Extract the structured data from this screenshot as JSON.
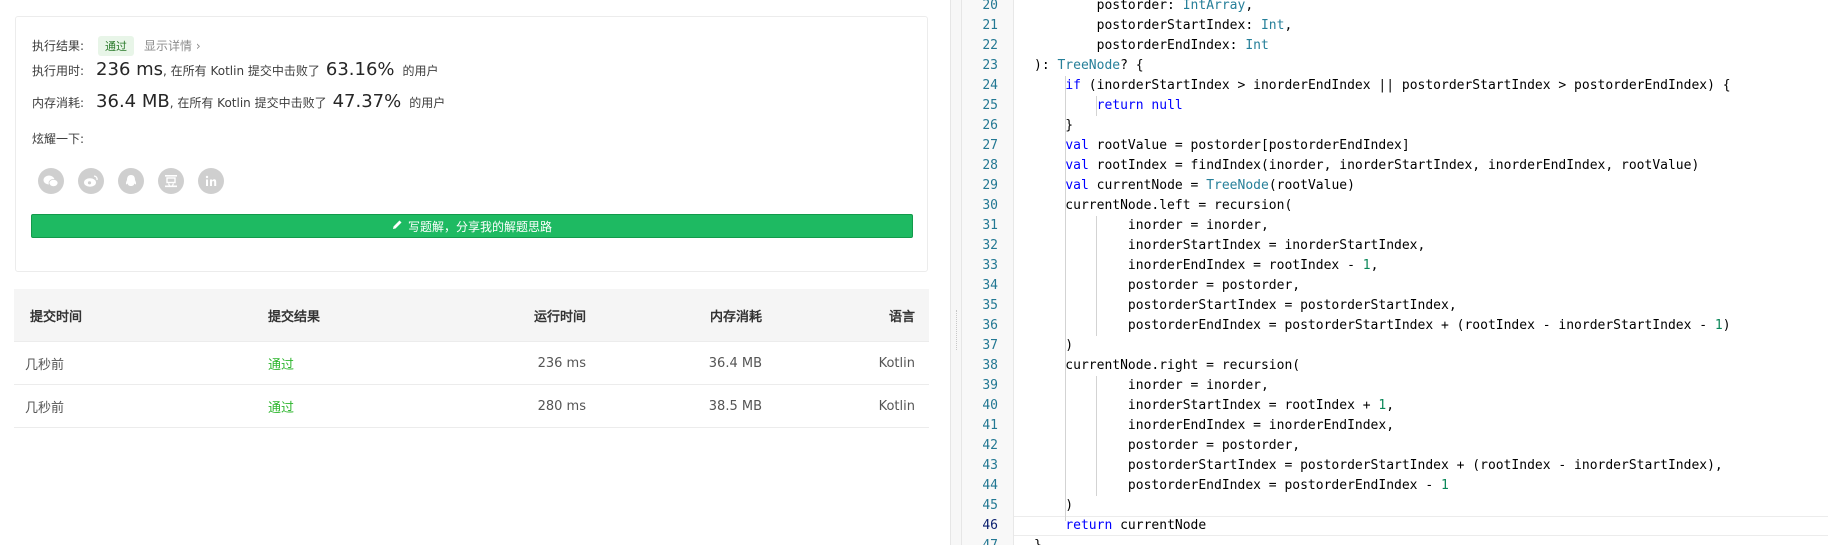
{
  "result": {
    "status_label": "执行结果:",
    "status_badge": "通过",
    "detail_link": "显示详情 ›",
    "runtime_label": "执行用时:",
    "runtime_value": "236 ms",
    "runtime_desc": ", 在所有 Kotlin 提交中击败了",
    "runtime_pct": "63.16%",
    "runtime_suffix": "的用户",
    "memory_label": "内存消耗:",
    "memory_value": "36.4 MB",
    "memory_desc": ", 在所有 Kotlin 提交中击败了",
    "memory_pct": "47.37%",
    "memory_suffix": "的用户",
    "share_label": "炫耀一下:",
    "share_icons": [
      "wechat-icon",
      "weibo-icon",
      "qq-icon",
      "douban-icon",
      "linkedin-icon"
    ],
    "write_button": "写题解，分享我的解题思路"
  },
  "submissions": {
    "headers": [
      "提交时间",
      "提交结果",
      "运行时间",
      "内存消耗",
      "语言"
    ],
    "rows": [
      [
        "几秒前",
        "通过",
        "236 ms",
        "36.4 MB",
        "Kotlin"
      ],
      [
        "几秒前",
        "通过",
        "280 ms",
        "38.5 MB",
        "Kotlin"
      ]
    ]
  },
  "editor": {
    "lines": [
      {
        "n": "20",
        "tokens": [
          [
            "",
            "        postorder: "
          ],
          [
            "ty",
            "IntArray"
          ],
          [
            "",
            ","
          ]
        ]
      },
      {
        "n": "21",
        "tokens": [
          [
            "",
            "        postorderStartIndex: "
          ],
          [
            "ty",
            "Int"
          ],
          [
            "",
            ","
          ]
        ]
      },
      {
        "n": "22",
        "tokens": [
          [
            "",
            "        postorderEndIndex: "
          ],
          [
            "ty",
            "Int"
          ]
        ]
      },
      {
        "n": "23",
        "tokens": [
          [
            "",
            "): "
          ],
          [
            "ty",
            "TreeNode"
          ],
          [
            "",
            "? {"
          ]
        ]
      },
      {
        "n": "24",
        "tokens": [
          [
            "",
            "    "
          ],
          [
            "kw",
            "if"
          ],
          [
            "",
            " (inorderStartIndex > inorderEndIndex || postorderStartIndex > postorderEndIndex) {"
          ]
        ]
      },
      {
        "n": "25",
        "tokens": [
          [
            "",
            "        "
          ],
          [
            "kw",
            "return"
          ],
          [
            "",
            " "
          ],
          [
            "kw",
            "null"
          ]
        ]
      },
      {
        "n": "26",
        "tokens": [
          [
            "",
            "    }"
          ]
        ]
      },
      {
        "n": "27",
        "tokens": [
          [
            "",
            "    "
          ],
          [
            "kw",
            "val"
          ],
          [
            "",
            " rootValue = postorder[postorderEndIndex]"
          ]
        ]
      },
      {
        "n": "28",
        "tokens": [
          [
            "",
            "    "
          ],
          [
            "kw",
            "val"
          ],
          [
            "",
            " rootIndex = findIndex(inorder, inorderStartIndex, inorderEndIndex, rootValue)"
          ]
        ]
      },
      {
        "n": "29",
        "tokens": [
          [
            "",
            "    "
          ],
          [
            "kw",
            "val"
          ],
          [
            "",
            " currentNode = "
          ],
          [
            "ty",
            "TreeNode"
          ],
          [
            "",
            "(rootValue)"
          ]
        ]
      },
      {
        "n": "30",
        "tokens": [
          [
            "",
            "    currentNode.left = recursion("
          ]
        ]
      },
      {
        "n": "31",
        "tokens": [
          [
            "",
            "            inorder = inorder,"
          ]
        ]
      },
      {
        "n": "32",
        "tokens": [
          [
            "",
            "            inorderStartIndex = inorderStartIndex,"
          ]
        ]
      },
      {
        "n": "33",
        "tokens": [
          [
            "",
            "            inorderEndIndex = rootIndex - "
          ],
          [
            "num",
            "1"
          ],
          [
            "",
            ","
          ]
        ]
      },
      {
        "n": "34",
        "tokens": [
          [
            "",
            "            postorder = postorder,"
          ]
        ]
      },
      {
        "n": "35",
        "tokens": [
          [
            "",
            "            postorderStartIndex = postorderStartIndex,"
          ]
        ]
      },
      {
        "n": "36",
        "tokens": [
          [
            "",
            "            postorderEndIndex = postorderStartIndex + (rootIndex - inorderStartIndex - "
          ],
          [
            "num",
            "1"
          ],
          [
            "",
            ")"
          ]
        ]
      },
      {
        "n": "37",
        "tokens": [
          [
            "",
            "    )"
          ]
        ]
      },
      {
        "n": "38",
        "tokens": [
          [
            "",
            "    currentNode.right = recursion("
          ]
        ]
      },
      {
        "n": "39",
        "tokens": [
          [
            "",
            "            inorder = inorder,"
          ]
        ]
      },
      {
        "n": "40",
        "tokens": [
          [
            "",
            "            inorderStartIndex = rootIndex + "
          ],
          [
            "num",
            "1"
          ],
          [
            "",
            ","
          ]
        ]
      },
      {
        "n": "41",
        "tokens": [
          [
            "",
            "            inorderEndIndex = inorderEndIndex,"
          ]
        ]
      },
      {
        "n": "42",
        "tokens": [
          [
            "",
            "            postorder = postorder,"
          ]
        ]
      },
      {
        "n": "43",
        "tokens": [
          [
            "",
            "            postorderStartIndex = postorderStartIndex + (rootIndex - inorderStartIndex),"
          ]
        ]
      },
      {
        "n": "44",
        "tokens": [
          [
            "",
            "            postorderEndIndex = postorderEndIndex - "
          ],
          [
            "num",
            "1"
          ]
        ]
      },
      {
        "n": "45",
        "tokens": [
          [
            "",
            "    )"
          ]
        ]
      },
      {
        "n": "46",
        "tokens": [
          [
            "",
            "    "
          ],
          [
            "kw",
            "return"
          ],
          [
            "",
            " currentNode"
          ]
        ],
        "current": true
      },
      {
        "n": "47",
        "tokens": [
          [
            "",
            "}"
          ]
        ]
      }
    ]
  },
  "colors": {
    "accent_green": "#1eba62",
    "pass_green": "#2db52d",
    "keyword": "#0000ff",
    "type": "#267f99",
    "number": "#098658",
    "line_number": "#237893"
  }
}
